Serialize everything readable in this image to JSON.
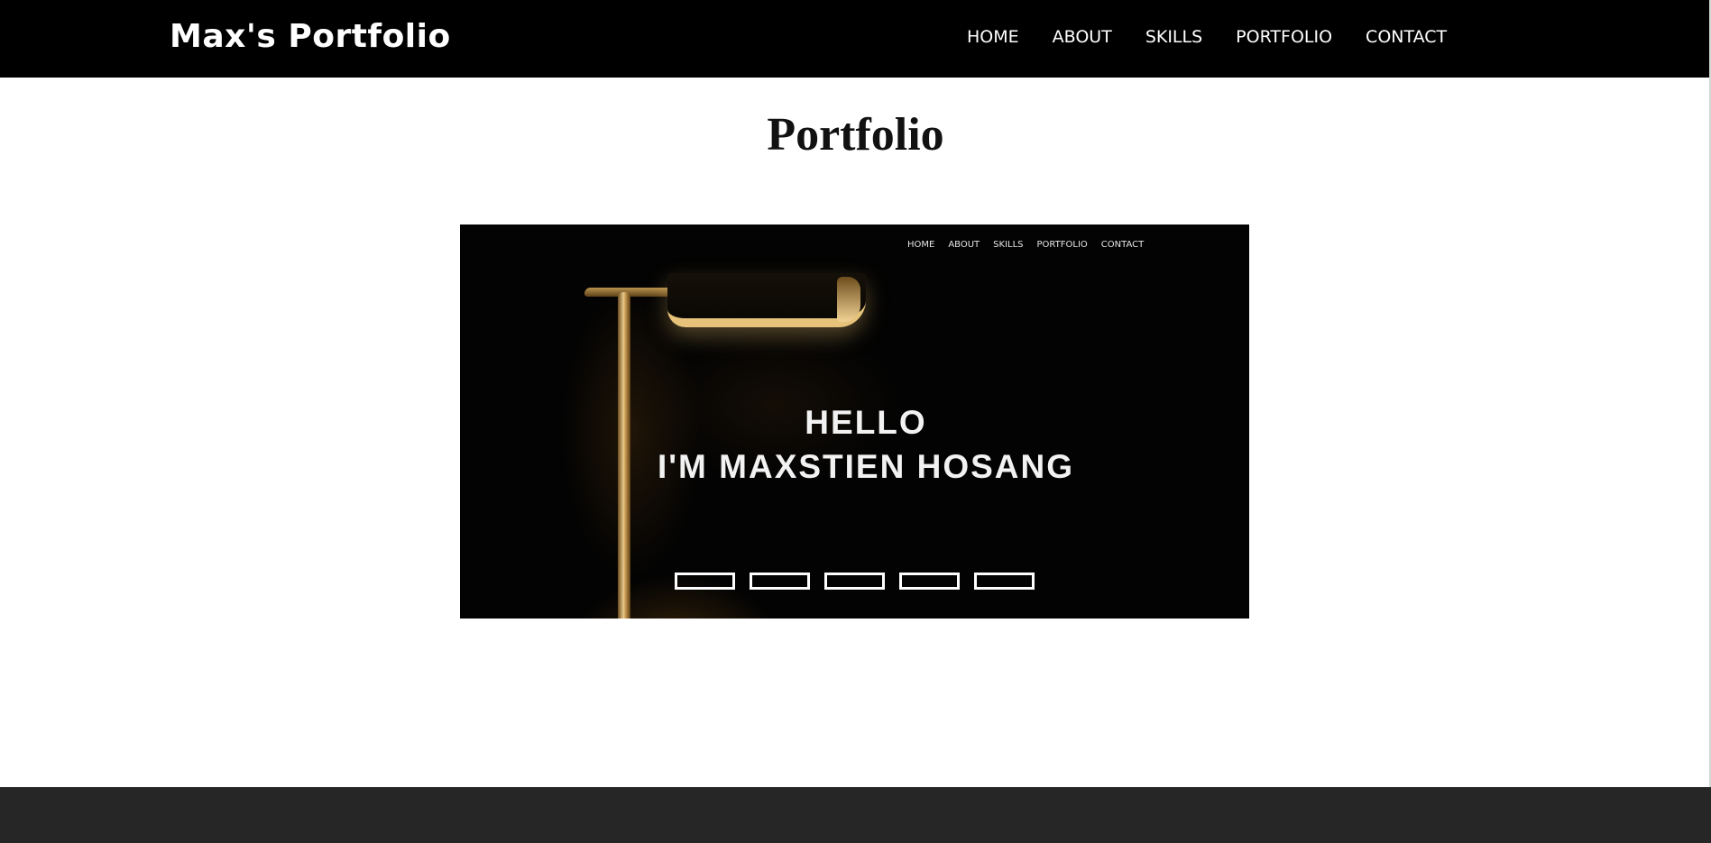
{
  "navbar": {
    "brand": "Max's Portfolio",
    "links": [
      "HOME",
      "ABOUT",
      "SKILLS",
      "PORTFOLIO",
      "CONTACT"
    ]
  },
  "main": {
    "title": "Portfolio",
    "project_preview": {
      "nav": [
        "HOME",
        "ABOUT",
        "SKILLS",
        "PORTFOLIO",
        "CONTACT"
      ],
      "hero_line1": "HELLO",
      "hero_line2": "I'M MAXSTIEN HOSANG",
      "slide_indicator_count": 5
    }
  },
  "colors": {
    "navbar_bg": "#000000",
    "page_bg": "#ffffff",
    "footer_bg": "#262626",
    "lamp_glow": "#e6c27a"
  }
}
